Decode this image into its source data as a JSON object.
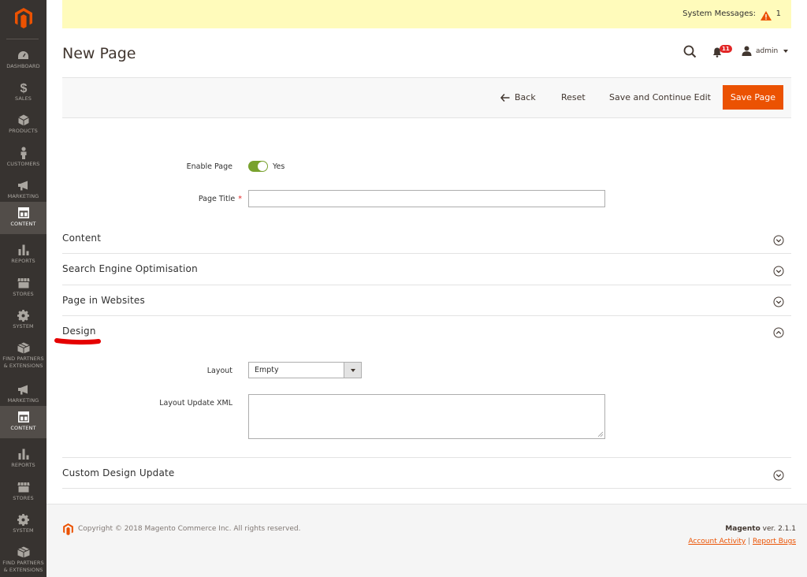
{
  "sidebar": {
    "logo": "magento-logo",
    "items": [
      {
        "label": "DASHBOARD",
        "icon": "dashboard-icon"
      },
      {
        "label": "SALES",
        "icon": "dollar-icon"
      },
      {
        "label": "PRODUCTS",
        "icon": "cube-icon"
      },
      {
        "label": "CUSTOMERS",
        "icon": "person-icon"
      },
      {
        "label": "MARKETING",
        "icon": "megaphone-icon"
      },
      {
        "label": "CONTENT",
        "icon": "layout-icon",
        "active": true
      },
      {
        "label": "REPORTS",
        "icon": "bar-chart-icon"
      },
      {
        "label": "STORES",
        "icon": "store-icon"
      },
      {
        "label": "SYSTEM",
        "icon": "gear-icon"
      },
      {
        "label": "FIND PARTNERS & EXTENSIONS",
        "icon": "box-icon"
      },
      {
        "label": "MARKETING",
        "icon": "megaphone-icon"
      },
      {
        "label": "CONTENT",
        "icon": "layout-icon",
        "active": true
      },
      {
        "label": "REPORTS",
        "icon": "bar-chart-icon"
      },
      {
        "label": "STORES",
        "icon": "store-icon"
      },
      {
        "label": "SYSTEM",
        "icon": "gear-icon"
      },
      {
        "label": "FIND PARTNERS & EXTENSIONS",
        "icon": "box-icon"
      }
    ]
  },
  "notice": {
    "text": "System Messages:",
    "count": "1"
  },
  "header": {
    "title": "New Page",
    "notification_count": "11",
    "user": "admin"
  },
  "actions": {
    "back": "Back",
    "reset": "Reset",
    "save_continue": "Save and Continue Edit",
    "save": "Save Page"
  },
  "form": {
    "enable_label": "Enable Page",
    "enable_value": "Yes",
    "title_label": "Page Title",
    "title_value": "",
    "required_mark": "*"
  },
  "sections": {
    "content": "Content",
    "seo": "Search Engine Optimisation",
    "websites": "Page in Websites",
    "design": "Design",
    "custom_design": "Custom Design Update"
  },
  "design": {
    "layout_label": "Layout",
    "layout_value": "Empty",
    "xml_label": "Layout Update XML",
    "xml_value": ""
  },
  "footer": {
    "copyright": "Copyright © 2018 Magento Commerce Inc. All rights reserved.",
    "brand": "Magento",
    "version": " ver. 2.1.1",
    "account_activity": "Account Activity",
    "separator": " | ",
    "report_bugs": "Report Bugs"
  },
  "colors": {
    "accent": "#eb5202",
    "sidebar": "#373330",
    "toggle_on": "#79a22e",
    "notice_bg": "#fffbbb"
  }
}
